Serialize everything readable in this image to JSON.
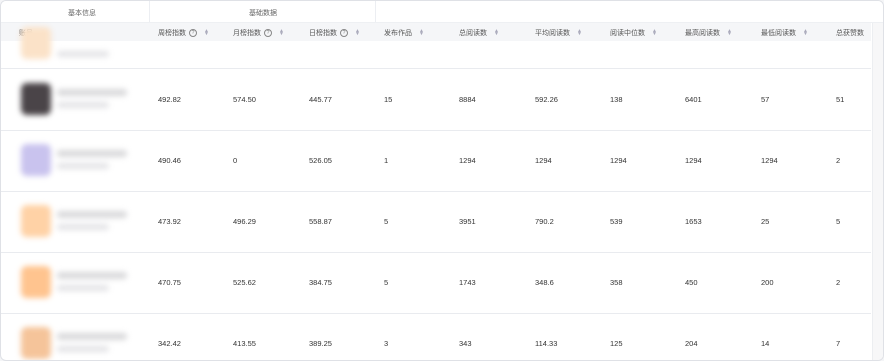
{
  "group_headers": {
    "basic": "基本信息",
    "data": "基础数据"
  },
  "columns": {
    "account": "账号",
    "weekly": "周榜指数",
    "monthly": "月榜指数",
    "daily": "日榜指数",
    "published": "发布作品",
    "total_reads": "总阅读数",
    "avg_reads": "平均阅读数",
    "median_reads": "阅读中位数",
    "max_reads": "最高阅读数",
    "min_reads": "最低阅读数",
    "total_likes": "总获赞数"
  },
  "rows": [
    {
      "avatar_color": "#4a4448",
      "weekly": "492.82",
      "monthly": "574.50",
      "daily": "445.77",
      "published": "15",
      "total_reads": "8884",
      "avg_reads": "592.26",
      "median_reads": "138",
      "max_reads": "6401",
      "min_reads": "57",
      "total_likes": "51"
    },
    {
      "avatar_color": "#c9c3ee",
      "weekly": "490.46",
      "monthly": "0",
      "daily": "526.05",
      "published": "1",
      "total_reads": "1294",
      "avg_reads": "1294",
      "median_reads": "1294",
      "max_reads": "1294",
      "min_reads": "1294",
      "total_likes": "2"
    },
    {
      "avatar_color": "#ffd2a6",
      "weekly": "473.92",
      "monthly": "496.29",
      "daily": "558.87",
      "published": "5",
      "total_reads": "3951",
      "avg_reads": "790.2",
      "median_reads": "539",
      "max_reads": "1653",
      "min_reads": "25",
      "total_likes": "5"
    },
    {
      "avatar_color": "#ffc48f",
      "weekly": "470.75",
      "monthly": "525.62",
      "daily": "384.75",
      "published": "5",
      "total_reads": "1743",
      "avg_reads": "348.6",
      "median_reads": "358",
      "max_reads": "450",
      "min_reads": "200",
      "total_likes": "2"
    },
    {
      "avatar_color": "#f5c49a",
      "weekly": "342.42",
      "monthly": "413.55",
      "daily": "389.25",
      "published": "3",
      "total_reads": "343",
      "avg_reads": "114.33",
      "median_reads": "125",
      "max_reads": "204",
      "min_reads": "14",
      "total_likes": "7"
    }
  ]
}
